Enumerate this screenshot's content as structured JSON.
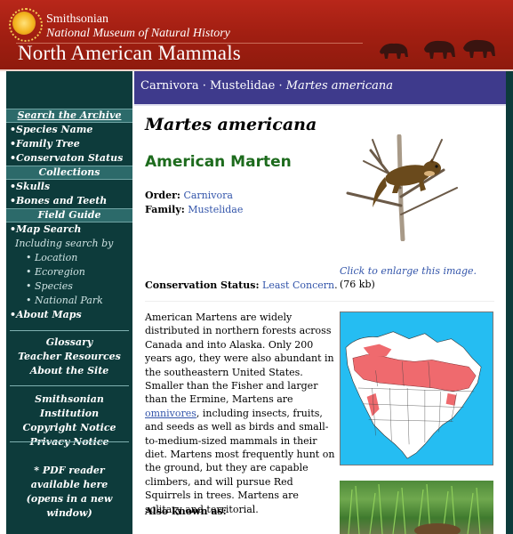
{
  "header": {
    "org": "Smithsonian",
    "museum": "National Museum of Natural History",
    "title": "North American Mammals"
  },
  "breadcrumb": {
    "order": "Carnivora",
    "family": "Mustelidae",
    "species": "Martes americana",
    "sep": " · "
  },
  "nav": {
    "search_head": "Search the Archive",
    "search_items": [
      "Species Name",
      "Family Tree",
      "Conservaton Status"
    ],
    "collections_head": "Collections",
    "collections_items": [
      "Skulls",
      "Bones and Teeth"
    ],
    "field_head": "Field Guide",
    "map_search": "Map Search",
    "including": "Including search by",
    "sub_items": [
      "Location",
      "Ecoregion",
      "Species",
      "National Park"
    ],
    "about_maps": "About Maps",
    "links1": [
      "Glossary",
      "Teacher Resources",
      "About the Site"
    ],
    "links2": [
      "Smithsonian Institution",
      "Copyright Notice",
      "Privacy Notice"
    ],
    "pdf": [
      "* PDF reader",
      "available here",
      "(opens in a new window)"
    ]
  },
  "species": {
    "scientific_name": "Martes americana",
    "common_name": "American Marten",
    "order_label": "Order:",
    "order_value": "Carnivora",
    "family_label": "Family:",
    "family_value": "Mustelidae",
    "conservation_label": "Conservation Status:",
    "conservation_value": "Least Concern",
    "enlarge_link": "Click to enlarge this image.",
    "enlarge_size": "(76 kb)",
    "description_before": "American Martens are widely distributed in northern forests across Canada and into Alaska. Only 200 years ago, they were also abundant in the southeastern United States. Smaller than the Fisher and larger than the Ermine, Martens are ",
    "description_link": "omnivores",
    "description_after": ", including insects, fruits, and seeds as well as birds and small-to-medium-sized mammals in their diet. Martens most frequently hunt on the ground, but they are capable climbers, and will pursue Red Squirrels in trees. Martens are solitary and territorial.",
    "also_known_as_label": "Also known as:"
  },
  "colors": {
    "banner_red": "#a31f12",
    "nav_teal": "#0d3b3b",
    "crumb_purple": "#3e3a8c",
    "common_name_green": "#1d6b1d",
    "link_blue": "#3355aa"
  }
}
